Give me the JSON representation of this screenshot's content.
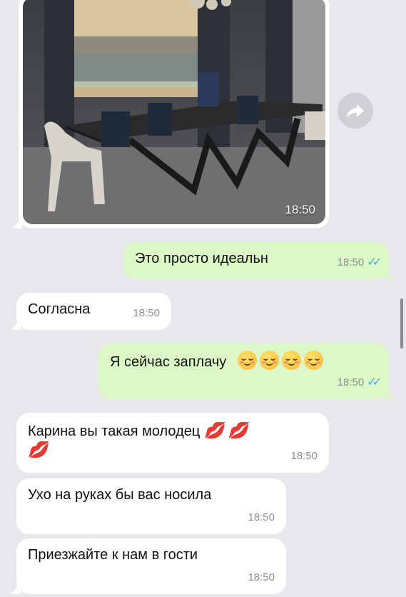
{
  "photo": {
    "time": "18:50"
  },
  "forward": {
    "icon": "forward-arrow-icon"
  },
  "messages": [
    {
      "text": "Это просто идеальн",
      "time": "18:50",
      "direction": "out",
      "status": "read"
    },
    {
      "text": "Согласна",
      "time": "18:50",
      "direction": "in"
    },
    {
      "text": "Я сейчас заплачу",
      "emojis": [
        "☺️",
        "☺️",
        "☺️",
        "☺️"
      ],
      "time": "18:50",
      "direction": "out",
      "status": "read"
    },
    {
      "text": "Карина вы такая молодец",
      "emojis": [
        "💋",
        "💋",
        "💋"
      ],
      "time": "18:50",
      "direction": "in"
    },
    {
      "text": "Ухо на руках бы вас носила",
      "time": "18:50",
      "direction": "in"
    },
    {
      "text": "Приезжайте к нам в гости",
      "time": "18:50",
      "direction": "in"
    }
  ],
  "colors": {
    "background": "#e7e7ec",
    "incoming": "#ffffff",
    "outgoing": "#dcf8c6",
    "read_ticks": "#4fa3e0"
  }
}
